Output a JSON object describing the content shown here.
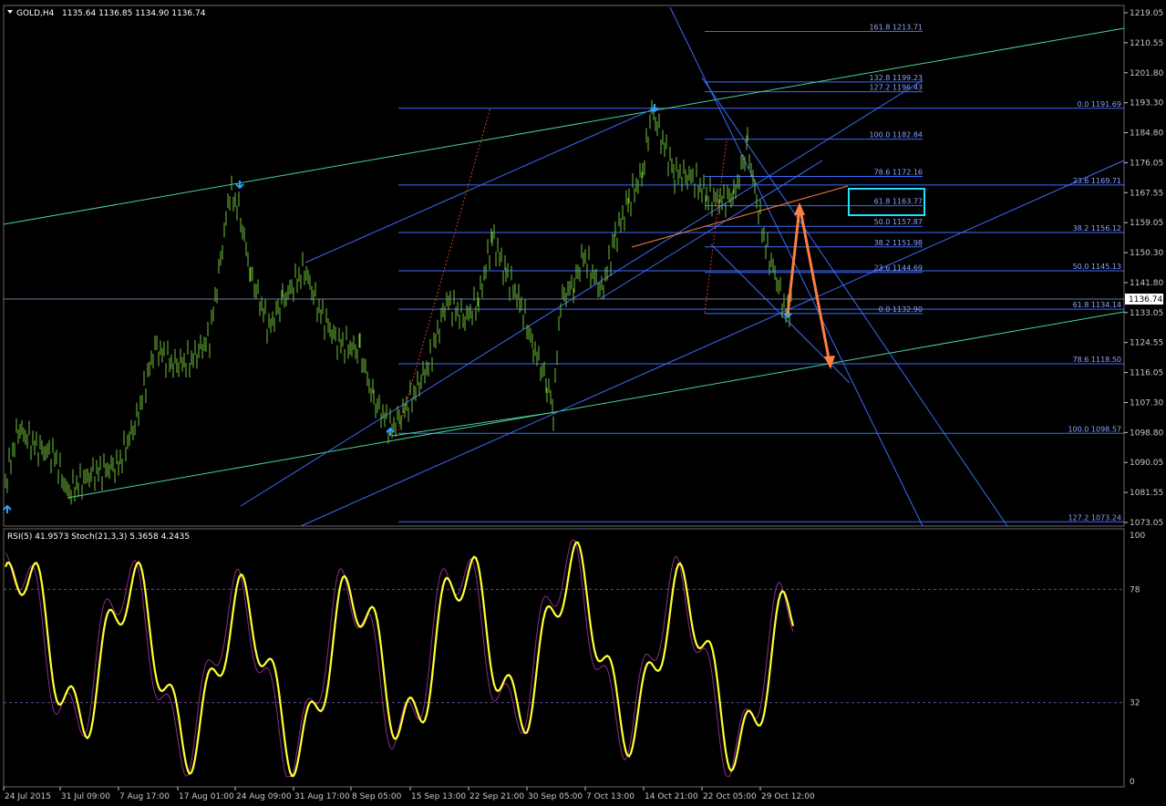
{
  "window": {
    "symbol_label": "GOLD,H4",
    "ohlc": "1135.64 1136.85 1134.90 1136.74",
    "current_price": "1136.74"
  },
  "colors": {
    "background": "#000000",
    "candle": "#6fbf3a",
    "fib": "#3b6cff",
    "channel_green": "#48d39a",
    "channel_blue": "#3b6cff",
    "red_dotted": "#d43a2a",
    "orange": "#ff7f3f",
    "cyan_box": "#22e0ff",
    "arrow_marker": "#2aa2ff",
    "rsi": "#ffff33",
    "stoch": "#8a2d88",
    "grid_text": "#c8c8c8"
  },
  "price_axis": {
    "labels": [
      "1219.05",
      "1210.55",
      "1201.80",
      "1193.30",
      "1184.80",
      "1176.05",
      "1167.55",
      "1159.05",
      "1150.30",
      "1141.80",
      "1133.05",
      "1124.55",
      "1116.05",
      "1107.30",
      "1098.80",
      "1090.05",
      "1081.55",
      "1073.05"
    ]
  },
  "indicator": {
    "label": "RSI(5) 41.9573  Stoch(21,3,3) 5.3658 4.2435",
    "axis_labels": [
      "100",
      "78",
      "32",
      "0"
    ],
    "levels": [
      100,
      78,
      32,
      0
    ]
  },
  "time_axis": {
    "labels": [
      "24 Jul 2015",
      "31 Jul 09:00",
      "7 Aug 17:00",
      "17 Aug 01:00",
      "24 Aug 09:00",
      "31 Aug 17:00",
      "8 Sep 05:00",
      "15 Sep 13:00",
      "22 Sep 21:00",
      "30 Sep 05:00",
      "7 Oct 13:00",
      "14 Oct 21:00",
      "22 Oct 05:00",
      "29 Oct 12:00"
    ]
  },
  "fib_levels": [
    {
      "label": "161.8  1213.71"
    },
    {
      "label": "132.8  1199.23"
    },
    {
      "label": "127.2  1196.43"
    },
    {
      "label": "0.0  1191.69"
    },
    {
      "label": "100.0  1182.84"
    },
    {
      "label": "78.6  1172.16"
    },
    {
      "label": "23.6  1169.71"
    },
    {
      "label": "61.8  1163.77"
    },
    {
      "label": "50.0  1157.87"
    },
    {
      "label": "38.2  1156.12"
    },
    {
      "label": "38.2  1151.98"
    },
    {
      "label": "23.6  1144.69"
    },
    {
      "label": "50.0  1145.13"
    },
    {
      "label": "61.8  1134.14"
    },
    {
      "label": "0.0  1132.90"
    },
    {
      "label": "78.6  1118.50"
    },
    {
      "label": "100.0  1098.57"
    },
    {
      "label": "127.2  1073.24"
    }
  ],
  "chart_data": {
    "type": "line",
    "title": "GOLD,H4",
    "x": [
      "24 Jul 2015",
      "31 Jul 09:00",
      "7 Aug 17:00",
      "17 Aug 01:00",
      "24 Aug 09:00",
      "31 Aug 17:00",
      "8 Sep 05:00",
      "15 Sep 13:00",
      "22 Sep 21:00",
      "30 Sep 05:00",
      "7 Oct 13:00",
      "14 Oct 21:00",
      "22 Oct 05:00",
      "29 Oct 12:00"
    ],
    "ylim": [
      1073.05,
      1219.05
    ],
    "series": [
      {
        "name": "GOLD,H4",
        "values": [
          1100,
          1085,
          1120,
          1160,
          1140,
          1125,
          1102,
          1140,
          1145,
          1105,
          1150,
          1188,
          1165,
          1136.74
        ]
      },
      {
        "name": "RSI(5)",
        "values": [
          55,
          40,
          70,
          35,
          80,
          30,
          35,
          90,
          45,
          20,
          85,
          60,
          35,
          41.9573
        ]
      },
      {
        "name": "Stoch(21,3,3)",
        "values": [
          50,
          30,
          75,
          30,
          85,
          25,
          20,
          85,
          50,
          15,
          90,
          55,
          20,
          5.3658
        ]
      }
    ]
  }
}
